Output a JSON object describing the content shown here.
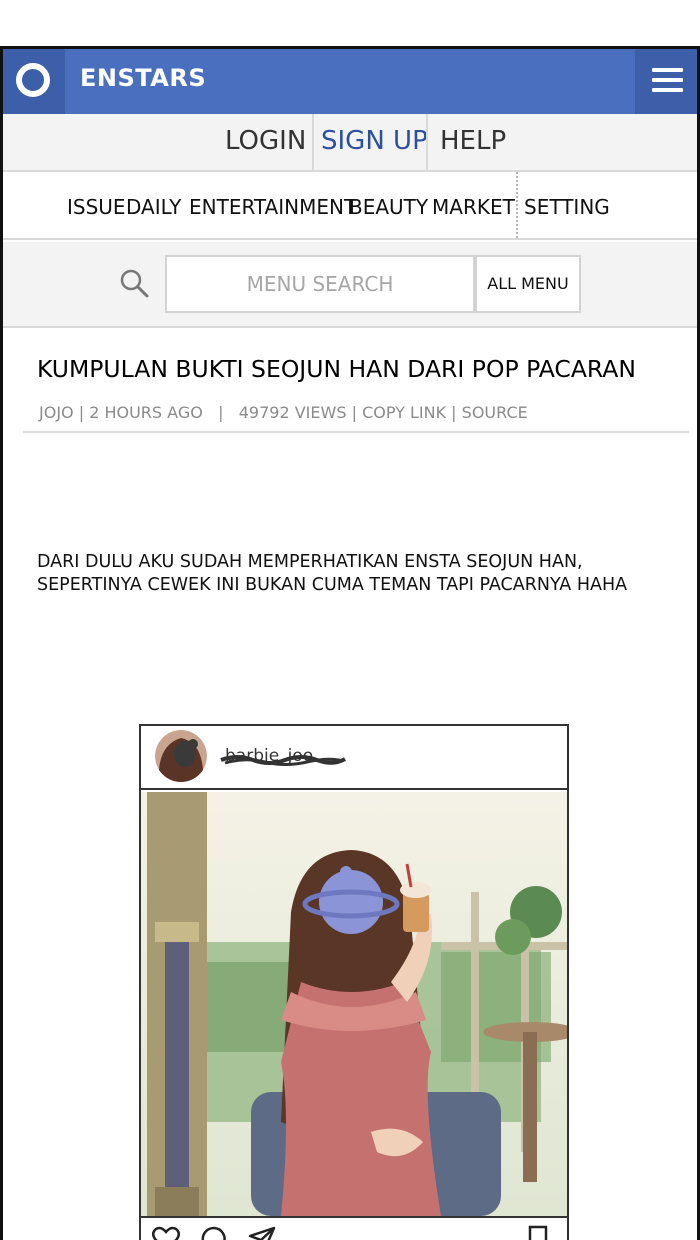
{
  "header": {
    "brand": "ENSTARS",
    "accent_color": "#4b6fbf",
    "dark_accent_color": "#3d5ea8",
    "logo_icon": "ring-logo-icon",
    "menu_icon": "hamburger-menu-icon"
  },
  "auth": {
    "login": "LOGIN",
    "signup": "SIGN UP",
    "help": "HELP"
  },
  "nav": {
    "items": [
      "ISSUE",
      "DAILY",
      "ENTERTAINMENT",
      "BEAUTY",
      "MARKET",
      "SETTING"
    ]
  },
  "search": {
    "placeholder": "MENU SEARCH",
    "all_menu": "ALL MENU",
    "icon": "search-icon"
  },
  "article": {
    "title": "KUMPULAN BUKTI SEOJUN HAN DARI POP PACARAN",
    "meta": {
      "author": "JOJO",
      "time": "2 HOURS AGO",
      "views": "49792 VIEWS",
      "copy_link": "COPY LINK",
      "source": "SOURCE"
    },
    "body_lines": [
      "DARI DULU AKU SUDAH MEMPERHATIKAN ENSTA SEOJUN HAN,",
      "SEPERTINYA CEWEK INI BUKAN CUMA TEMAN TAPI PACARNYA HAHA"
    ]
  },
  "post": {
    "username": "barbie_joo",
    "icons": [
      "heart-icon",
      "comment-icon",
      "send-icon",
      "bookmark-icon"
    ]
  }
}
